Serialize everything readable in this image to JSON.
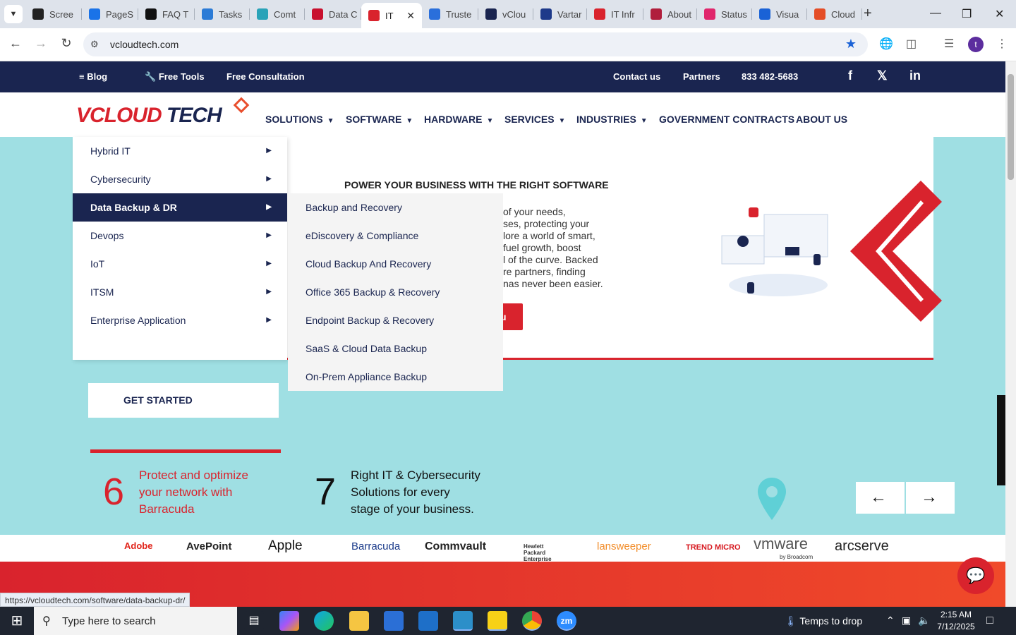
{
  "browser": {
    "tabs": [
      {
        "title": "Scree",
        "favicon_color": "#222222"
      },
      {
        "title": "PageS",
        "favicon_color": "#1a73e8"
      },
      {
        "title": "FAQ T",
        "favicon_color": "#111111"
      },
      {
        "title": "Tasks",
        "favicon_color": "#2b7bd6"
      },
      {
        "title": "Comt",
        "favicon_color": "#2aa3b8"
      },
      {
        "title": "Data C",
        "favicon_color": "#c8102e"
      },
      {
        "title": "IT",
        "favicon_color": "#d9232d",
        "active": true
      },
      {
        "title": "Truste",
        "favicon_color": "#2a6fdb"
      },
      {
        "title": "vClou",
        "favicon_color": "#1a2550"
      },
      {
        "title": "Vartar",
        "favicon_color": "#1e3a8a"
      },
      {
        "title": "IT Infr",
        "favicon_color": "#d9232d"
      },
      {
        "title": "About",
        "favicon_color": "#b01e3c"
      },
      {
        "title": "Status",
        "favicon_color": "#e0266c"
      },
      {
        "title": "Visua",
        "favicon_color": "#1a62d6"
      },
      {
        "title": "Cloud",
        "favicon_color": "#e44d26"
      }
    ],
    "url": "vcloudtech.com",
    "profile_initial": "t",
    "status_url": "https://vcloudtech.com/software/data-backup-dr/"
  },
  "site": {
    "topbar": {
      "blog": "Blog",
      "free_tools": "Free Tools",
      "free_consultation": "Free Consultation",
      "contact": "Contact us",
      "partners": "Partners",
      "phone": "833 482-5683"
    },
    "logo": {
      "part1": "VCLOUD",
      "part2": " TECH"
    },
    "nav": [
      {
        "label": "SOLUTIONS"
      },
      {
        "label": "SOFTWARE"
      },
      {
        "label": "HARDWARE"
      },
      {
        "label": "SERVICES"
      },
      {
        "label": "INDUSTRIES"
      },
      {
        "label": "GOVERNMENT CONTRACTS"
      },
      {
        "label": "ABOUT US"
      }
    ],
    "software_menu": [
      "Hybrid IT",
      "Cybersecurity",
      "Data Backup & DR",
      "Devops",
      "IoT",
      "ITSM",
      "Enterprise Application"
    ],
    "backup_submenu": [
      "Backup and Recovery",
      "eDiscovery & Compliance",
      "Cloud Backup And Recovery",
      "Office 365 Backup & Recovery",
      "Endpoint Backup & Recovery",
      "SaaS & Cloud Data Backup",
      "On-Prem Appliance Backup"
    ],
    "hero": {
      "heading": "POWER YOUR BUSINESS WITH THE RIGHT SOFTWARE",
      "body_lines": [
        "of your needs,",
        "ses, protecting your",
        "lore a world of smart,",
        "fuel growth, boost",
        "l of the curve. Backed",
        "re partners, finding",
        "nas never been easier."
      ],
      "cta_partial": "u"
    },
    "get_started": "GET STARTED",
    "features": [
      {
        "number": "6",
        "text": "Protect and optimize\nyour network with\nBarracuda"
      },
      {
        "number": "7",
        "text": "Right IT & Cybersecurity\nSolutions for every\nstage of your business."
      }
    ],
    "partners": [
      "Adobe",
      "AvePoint",
      "Apple",
      "Barracuda",
      "Commvault",
      "Hewlett Packard Enterprise",
      "lansweeper",
      "TREND MICRO",
      "vmware",
      "arcserve"
    ],
    "partners_sub": {
      "vmware_by": "by Broadcom"
    }
  },
  "taskbar": {
    "search_placeholder": "Type here to search",
    "weather": "Temps to drop",
    "time": "2:15 AM",
    "date": "7/12/2025"
  },
  "colors": {
    "navy": "#1a2550",
    "brand_red": "#d9232d",
    "hero_bg": "#9fdfe3"
  }
}
